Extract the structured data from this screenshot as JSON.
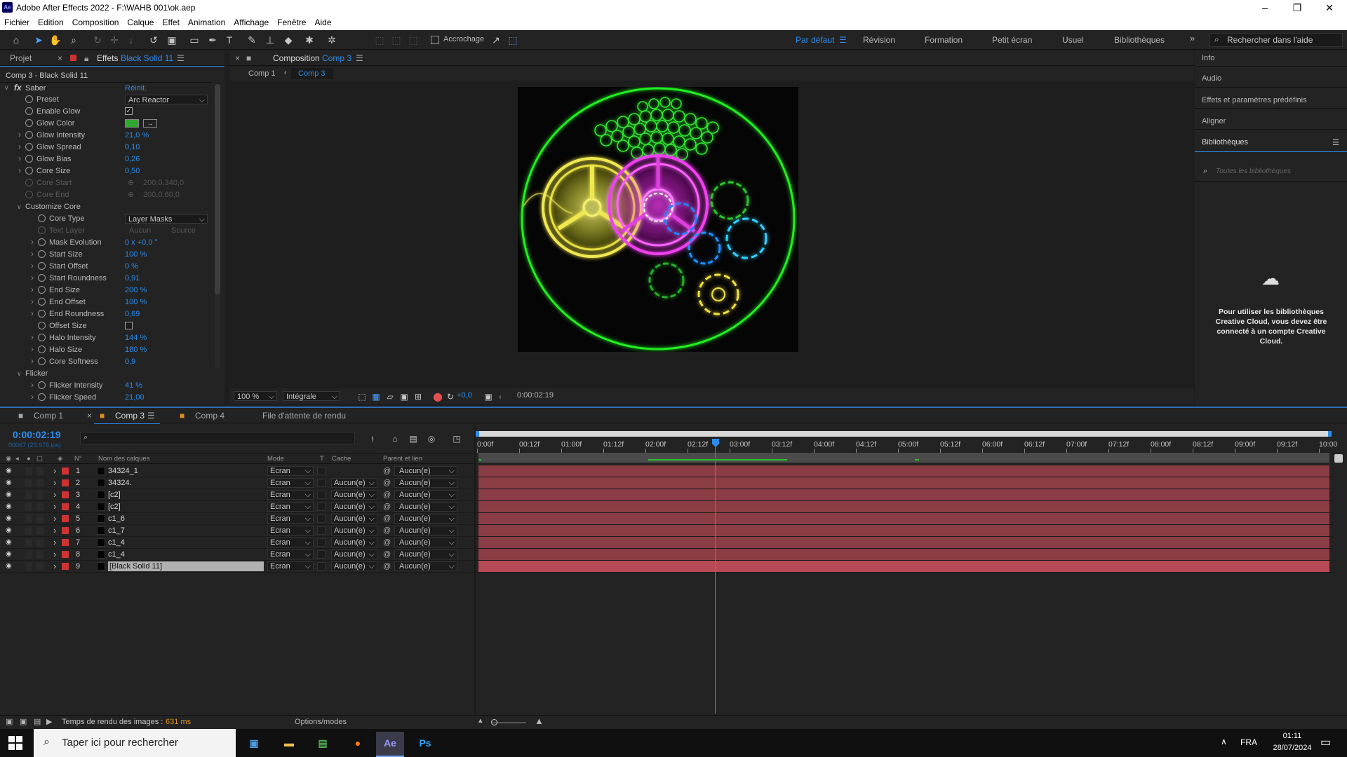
{
  "window": {
    "title": "Adobe After Effects 2022 - F:\\WAHB 001\\ok.aep",
    "app_icon": "Ae"
  },
  "menu": [
    "Fichier",
    "Edition",
    "Composition",
    "Calque",
    "Effet",
    "Animation",
    "Affichage",
    "Fenêtre",
    "Aide"
  ],
  "toolbar": {
    "snap_label": "Accrochage",
    "workspaces": [
      "Par défaut",
      "Révision",
      "Formation",
      "Petit écran",
      "Usuel",
      "Bibliothèques"
    ],
    "help_placeholder": "Rechercher dans l'aide"
  },
  "effects_panel": {
    "tabs": {
      "project": "Projet",
      "effects": "Effets",
      "layer": "Black Solid 11"
    },
    "subtitle": "Comp 3 - Black Solid 11",
    "effect_name": "Saber",
    "reset": "Réinit.",
    "props": [
      {
        "label": "Preset",
        "value": "Arc Reactor",
        "kind": "dropdown",
        "indent": 1
      },
      {
        "label": "Enable Glow",
        "value": "✓",
        "kind": "check",
        "indent": 1
      },
      {
        "label": "Glow Color",
        "value": "#2fa82f",
        "kind": "color",
        "indent": 1
      },
      {
        "label": "Glow Intensity",
        "value": "21,0 %",
        "kind": "num",
        "indent": 1,
        "twirl": true
      },
      {
        "label": "Glow Spread",
        "value": "0,10",
        "kind": "num",
        "indent": 1,
        "twirl": true
      },
      {
        "label": "Glow Bias",
        "value": "0,26",
        "kind": "num",
        "indent": 1,
        "twirl": true
      },
      {
        "label": "Core Size",
        "value": "0,50",
        "kind": "num",
        "indent": 1,
        "twirl": true
      },
      {
        "label": "Core Start",
        "value": "200,0,340,0",
        "kind": "dim",
        "indent": 1
      },
      {
        "label": "Core End",
        "value": "200,0,60,0",
        "kind": "dim",
        "indent": 1
      },
      {
        "label": "Customize Core",
        "kind": "group",
        "indent": 1
      },
      {
        "label": "Core Type",
        "value": "Layer Masks",
        "kind": "dropdown",
        "indent": 2
      },
      {
        "label": "Text Layer",
        "value": "Aucun",
        "kind": "dimdd",
        "indent": 2,
        "value2": "Source"
      },
      {
        "label": "Mask Evolution",
        "value": "0 x +0,0 °",
        "kind": "num",
        "indent": 2,
        "twirl": true
      },
      {
        "label": "Start Size",
        "value": "100 %",
        "kind": "num",
        "indent": 2,
        "twirl": true
      },
      {
        "label": "Start Offset",
        "value": "0 %",
        "kind": "num",
        "indent": 2,
        "twirl": true
      },
      {
        "label": "Start Roundness",
        "value": "0,91",
        "kind": "num",
        "indent": 2,
        "twirl": true
      },
      {
        "label": "End Size",
        "value": "200 %",
        "kind": "num",
        "indent": 2,
        "twirl": true
      },
      {
        "label": "End Offset",
        "value": "100 %",
        "kind": "num",
        "indent": 2,
        "twirl": true
      },
      {
        "label": "End Roundness",
        "value": "0,69",
        "kind": "num",
        "indent": 2,
        "twirl": true
      },
      {
        "label": "Offset Size",
        "value": "",
        "kind": "check",
        "indent": 2
      },
      {
        "label": "Halo Intensity",
        "value": "144 %",
        "kind": "num",
        "indent": 2,
        "twirl": true
      },
      {
        "label": "Halo Size",
        "value": "180 %",
        "kind": "num",
        "indent": 2,
        "twirl": true
      },
      {
        "label": "Core Softness",
        "value": "0,9",
        "kind": "num",
        "indent": 2,
        "twirl": true
      },
      {
        "label": "Flicker",
        "kind": "group",
        "indent": 1
      },
      {
        "label": "Flicker Intensity",
        "value": "41 %",
        "kind": "num",
        "indent": 2,
        "twirl": true
      },
      {
        "label": "Flicker Speed",
        "value": "21,00",
        "kind": "num",
        "indent": 2,
        "twirl": true
      }
    ]
  },
  "comp_panel": {
    "tab_prefix": "Composition",
    "tab_name": "Comp 3",
    "breadcrumbs": [
      "Comp 1",
      "Comp 3"
    ],
    "zoom": "100 %",
    "quality": "Intégrale",
    "exposure": "+0,0",
    "timecode": "0:00:02:19"
  },
  "right_panel": {
    "items": [
      "Info",
      "Audio",
      "Effets et paramètres prédéfinis",
      "Aligner",
      "Bibliothèques"
    ],
    "search_placeholder": "Toutes les bibliothèques",
    "message": "Pour utiliser les bibliothèques Creative Cloud, vous devez être connecté à un compte Creative Cloud."
  },
  "timeline": {
    "tabs": [
      "Comp 1",
      "Comp 3",
      "Comp 4",
      "File d'attente de rendu"
    ],
    "timecode": "0:00:02:19",
    "frames": "00067 (23.976 ips)",
    "headers": {
      "num": "N°",
      "name": "Nom des calques",
      "mode": "Mode",
      "t": "T",
      "cache": "Cache",
      "parent": "Parent et lien"
    },
    "layers": [
      {
        "n": "1",
        "name": "34324_1",
        "mode": "Ecran",
        "cache": "",
        "parent": "Aucun(e)"
      },
      {
        "n": "2",
        "name": "34324.",
        "mode": "Ecran",
        "cache": "Aucun(e)",
        "parent": "Aucun(e)"
      },
      {
        "n": "3",
        "name": "[c2]",
        "mode": "Ecran",
        "cache": "Aucun(e)",
        "parent": "Aucun(e)"
      },
      {
        "n": "4",
        "name": "[c2]",
        "mode": "Ecran",
        "cache": "Aucun(e)",
        "parent": "Aucun(e)"
      },
      {
        "n": "5",
        "name": "c1_6",
        "mode": "Ecran",
        "cache": "Aucun(e)",
        "parent": "Aucun(e)"
      },
      {
        "n": "6",
        "name": "c1_7",
        "mode": "Ecran",
        "cache": "Aucun(e)",
        "parent": "Aucun(e)"
      },
      {
        "n": "7",
        "name": "c1_4",
        "mode": "Ecran",
        "cache": "Aucun(e)",
        "parent": "Aucun(e)"
      },
      {
        "n": "8",
        "name": "c1_4",
        "mode": "Ecran",
        "cache": "Aucun(e)",
        "parent": "Aucun(e)"
      },
      {
        "n": "9",
        "name": "[Black Solid 11]",
        "mode": "Ecran",
        "cache": "Aucun(e)",
        "parent": "Aucun(e)"
      }
    ],
    "ruler": [
      "0:00f",
      "00:12f",
      "01:00f",
      "01:12f",
      "02:00f",
      "02:12f",
      "03:00f",
      "03:12f",
      "04:00f",
      "04:12f",
      "05:00f",
      "05:12f",
      "06:00f",
      "06:12f",
      "07:00f",
      "07:12f",
      "08:00f",
      "08:12f",
      "09:00f",
      "09:12f",
      "10:00"
    ],
    "footer_label": "Temps de rendu des images :",
    "render_time": "631 ms",
    "options": "Options/modes"
  },
  "taskbar": {
    "search_placeholder": "Taper ici pour rechercher",
    "lang": "FRA",
    "time": "01:11",
    "date": "28/07/2024",
    "apps": [
      "Ae",
      "Ps"
    ]
  }
}
